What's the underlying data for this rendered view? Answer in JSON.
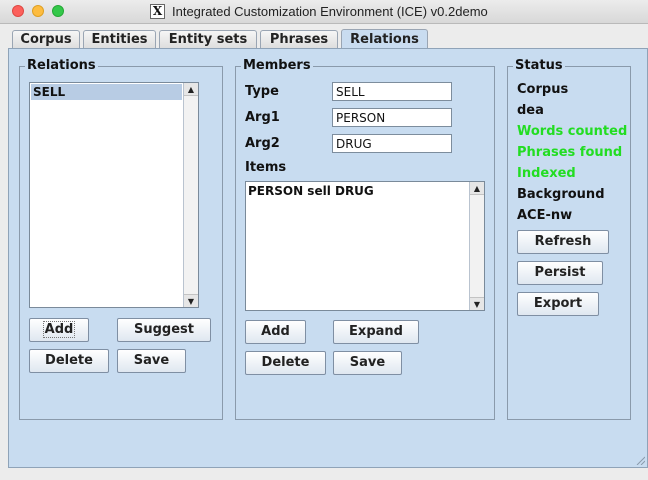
{
  "window": {
    "title": "Integrated Customization Environment (ICE) v0.2demo",
    "app_icon": "x11-icon"
  },
  "tabs": [
    {
      "label": "Corpus",
      "active": false
    },
    {
      "label": "Entities",
      "active": false
    },
    {
      "label": "Entity sets",
      "active": false
    },
    {
      "label": "Phrases",
      "active": false
    },
    {
      "label": "Relations",
      "active": true
    }
  ],
  "relations_group": {
    "title": "Relations",
    "items": [
      "SELL"
    ],
    "selected": "SELL",
    "buttons": {
      "add": "Add",
      "suggest": "Suggest",
      "delete": "Delete",
      "save": "Save"
    }
  },
  "members_group": {
    "title": "Members",
    "type": {
      "label": "Type",
      "value": "SELL"
    },
    "arg1": {
      "label": "Arg1",
      "value": "PERSON"
    },
    "arg2": {
      "label": "Arg2",
      "value": "DRUG"
    },
    "items_label": "Items",
    "items": [
      "PERSON sell DRUG"
    ],
    "buttons": {
      "add": "Add",
      "expand": "Expand",
      "delete": "Delete",
      "save": "Save"
    }
  },
  "status_group": {
    "title": "Status",
    "corpus_label": "Corpus",
    "corpus_name": "dea",
    "words_counted": "Words counted",
    "phrases_found": "Phrases found",
    "indexed": "Indexed",
    "background_label": "Background",
    "background_name": "ACE-nw",
    "status_color": "#22dd22",
    "buttons": {
      "refresh": "Refresh",
      "persist": "Persist",
      "export": "Export"
    }
  }
}
